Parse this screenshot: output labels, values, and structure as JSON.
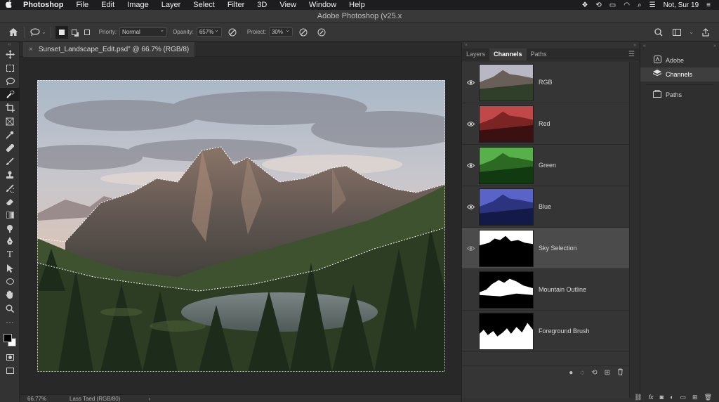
{
  "menubar": {
    "apple": "",
    "items": [
      "Photoshop",
      "File",
      "Edit",
      "Image",
      "Layer",
      "Select",
      "Filter",
      "3D",
      "View",
      "Window",
      "Help"
    ],
    "clock": "Not, Sur 19"
  },
  "window": {
    "title": "Adobe Photoshop (v25.x"
  },
  "options": {
    "priority_label": "Priorty:",
    "priority_value": "Normal",
    "opacity_label": "Opanity:",
    "opacity_value": "657%",
    "projext_label": "Proiect:",
    "projext_value": "30%"
  },
  "document": {
    "tab_title": "Sunset_Landscape_Edit.psd\" @ 66.7% (RGB/8)",
    "close": "×"
  },
  "status": {
    "zoom": "66.77%",
    "info": "Lass Taed (RGB/80)",
    "arrow": "›"
  },
  "channels_panel": {
    "tabs": [
      "Layers",
      "Channels",
      "Paths"
    ],
    "active_tab": "Channels",
    "channels": [
      {
        "name": "RGB",
        "visible": true,
        "selected": false
      },
      {
        "name": "Red",
        "visible": true,
        "selected": false
      },
      {
        "name": "Green",
        "visible": true,
        "selected": false
      },
      {
        "name": "Blue",
        "visible": true,
        "selected": false
      },
      {
        "name": "Sky Selection",
        "visible": true,
        "selected": true
      },
      {
        "name": "Mountain Outline",
        "visible": false,
        "selected": false
      },
      {
        "name": "Foreground Brush",
        "visible": false,
        "selected": false
      }
    ]
  },
  "side_panel": {
    "items": [
      {
        "label": "Adobe",
        "icon": "adobe-icon"
      },
      {
        "label": "Channels",
        "icon": "layers-icon"
      },
      {
        "label": "Paths",
        "icon": "paths-icon"
      }
    ],
    "active": "Channels"
  },
  "colors": {
    "foreground": "#000000",
    "background": "#ffffff",
    "selected_row": "#4b4b4b"
  }
}
